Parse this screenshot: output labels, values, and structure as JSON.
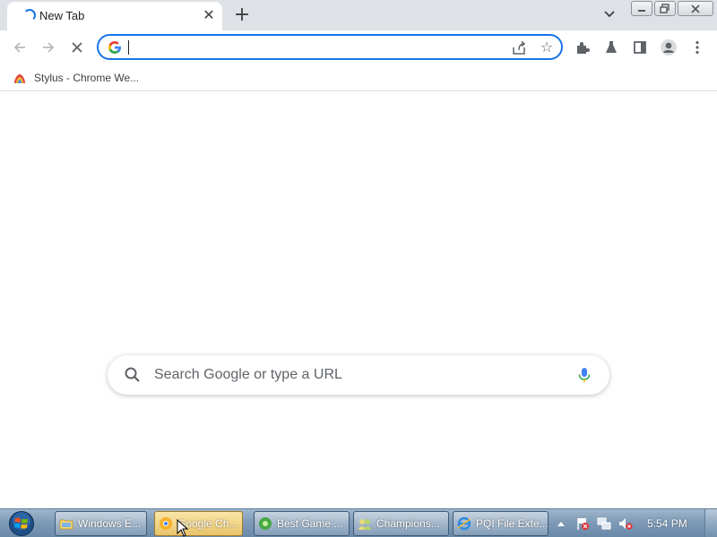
{
  "browser": {
    "tab": {
      "title": "New Tab",
      "close_glyph": "✕"
    },
    "new_tab_glyph": "+",
    "tab_search_glyph": "⌄",
    "window_controls": [
      "minimize",
      "restore",
      "close"
    ],
    "toolbar": {
      "back_icon": "arrow-left-icon",
      "forward_icon": "arrow-right-icon",
      "stop_icon": "close-x-icon",
      "omnibox_value": "",
      "star_glyph": "☆",
      "extensions_icon": "puzzle-icon",
      "labs_icon": "flask-icon",
      "side_panel_icon": "side-panel-icon",
      "profile_icon": "profile-icon",
      "menu_icon": "kebab-menu-icon"
    },
    "bookmarks": [
      {
        "label": "Stylus - Chrome We..."
      }
    ],
    "accent": "#1a73e8"
  },
  "ntp": {
    "search_placeholder": "Search Google or type a URL"
  },
  "taskbar": {
    "buttons": [
      {
        "label": "Windows E...",
        "active": false
      },
      {
        "label": "Google Ch...",
        "active": true
      },
      {
        "label": "Best Game ...",
        "active": false
      },
      {
        "label": "Champions...",
        "active": false
      },
      {
        "label": "PQI File Exte...",
        "active": false
      }
    ],
    "clock": "5:54 PM"
  }
}
